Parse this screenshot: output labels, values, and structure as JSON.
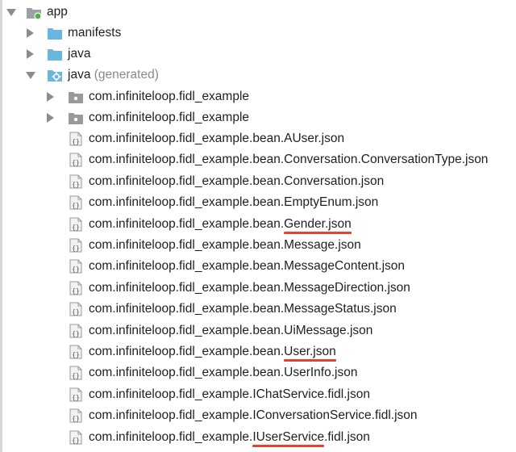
{
  "root": {
    "label": "app"
  },
  "folders": {
    "manifests": {
      "label": "manifests"
    },
    "java": {
      "label": "java"
    },
    "java_generated": {
      "label": "java",
      "suffix": "(generated)"
    }
  },
  "packages": [
    {
      "label": "com.infiniteloop.fidl_example"
    },
    {
      "label": "com.infiniteloop.fidl_example"
    }
  ],
  "files": [
    {
      "prefix": "com.infiniteloop.fidl_example.bean.",
      "highlight": "",
      "suffix": "AUser.json"
    },
    {
      "prefix": "com.infiniteloop.fidl_example.bean.",
      "highlight": "",
      "suffix": "Conversation.ConversationType.json"
    },
    {
      "prefix": "com.infiniteloop.fidl_example.bean.",
      "highlight": "",
      "suffix": "Conversation.json"
    },
    {
      "prefix": "com.infiniteloop.fidl_example.bean.",
      "highlight": "",
      "suffix": "EmptyEnum.json"
    },
    {
      "prefix": "com.infiniteloop.fidl_example.bean.",
      "highlight": "Gender.json",
      "suffix": ""
    },
    {
      "prefix": "com.infiniteloop.fidl_example.bean.",
      "highlight": "",
      "suffix": "Message.json"
    },
    {
      "prefix": "com.infiniteloop.fidl_example.bean.",
      "highlight": "",
      "suffix": "MessageContent.json"
    },
    {
      "prefix": "com.infiniteloop.fidl_example.bean.",
      "highlight": "",
      "suffix": "MessageDirection.json"
    },
    {
      "prefix": "com.infiniteloop.fidl_example.bean.",
      "highlight": "",
      "suffix": "MessageStatus.json"
    },
    {
      "prefix": "com.infiniteloop.fidl_example.bean.",
      "highlight": "",
      "suffix": "UiMessage.json"
    },
    {
      "prefix": "com.infiniteloop.fidl_example.bean.",
      "highlight": "User.json",
      "suffix": ""
    },
    {
      "prefix": "com.infiniteloop.fidl_example.bean.",
      "highlight": "",
      "suffix": "UserInfo.json"
    },
    {
      "prefix": "com.infiniteloop.fidl_example.",
      "highlight": "",
      "suffix": "IChatService.fidl.json"
    },
    {
      "prefix": "com.infiniteloop.fidl_example.",
      "highlight": "",
      "suffix": "IConversationService.fidl.json"
    },
    {
      "prefix": "com.infiniteloop.fidl_example.",
      "highlight": "IUserService",
      "suffix": ".fidl.json"
    }
  ],
  "icons": {
    "module": "module-folder-icon",
    "folder": "folder-icon",
    "generated_folder": "generated-source-folder-icon",
    "package": "package-icon",
    "json_file": "json-file-icon",
    "expanded": "chevron-down-icon",
    "collapsed": "chevron-right-icon"
  },
  "colors": {
    "folder": "#67b7e0",
    "module_dot": "#47b34a",
    "package": "#9a9a9a",
    "underline": "#e8402a",
    "muted_text": "#8a8a8a"
  }
}
